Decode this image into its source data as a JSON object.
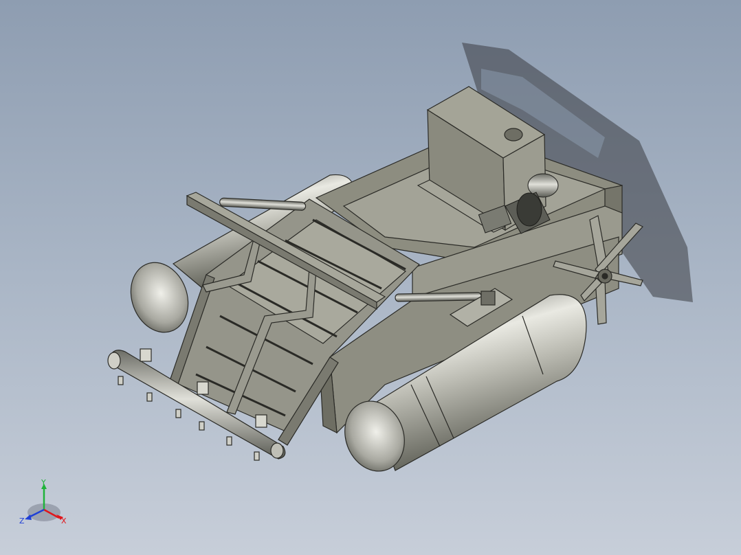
{
  "viewport": {
    "model": "3d-cad-assembly",
    "shading": "shaded-with-edges",
    "background_gradient": [
      "#8e9db1",
      "#c7ced9"
    ]
  },
  "triad": {
    "x_label": "X",
    "y_label": "Y",
    "z_label": "Z",
    "x_color": "#e0161b",
    "y_color": "#1fb33a",
    "z_color": "#1f3fd6"
  }
}
